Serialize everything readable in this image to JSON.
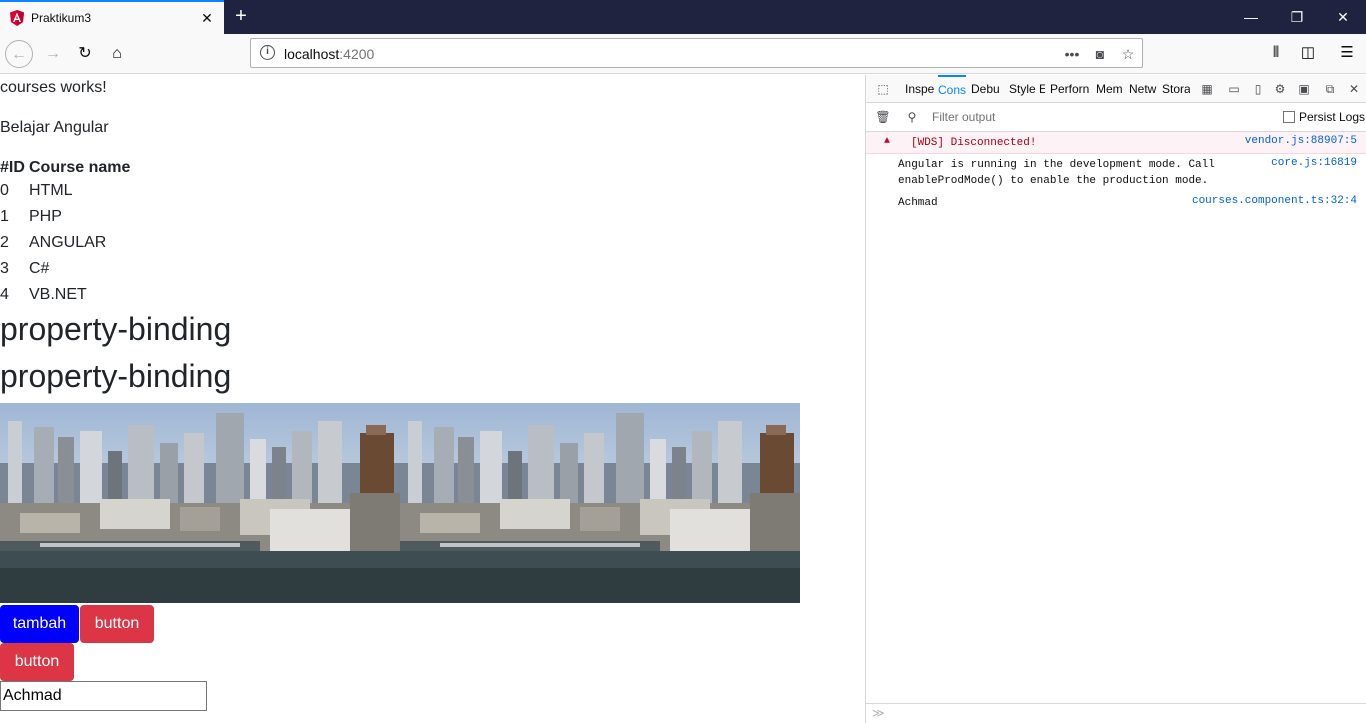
{
  "browser": {
    "tab_title": "Praktikum3",
    "url_host": "localhost",
    "url_port": ":4200"
  },
  "page": {
    "courses_works": "courses works!",
    "subtitle": "Belajar Angular",
    "table": {
      "headers": [
        "#ID",
        "Course name"
      ],
      "rows": [
        [
          "0",
          "HTML"
        ],
        [
          "1",
          "PHP"
        ],
        [
          "2",
          "ANGULAR"
        ],
        [
          "3",
          "C#"
        ],
        [
          "4",
          "VB.NET"
        ]
      ]
    },
    "heading_1": "property-binding",
    "heading_2": "property-binding",
    "buttons": {
      "tambah": "tambah",
      "button_1": "button",
      "button_2": "button"
    },
    "input_value": "Achmad"
  },
  "devtools": {
    "tabs": [
      "Inspe",
      "Cons",
      "Debu",
      "Style E",
      "Perforn",
      "Mem",
      "Netw",
      "Stora"
    ],
    "filter_placeholder": "Filter output",
    "persist_logs": "Persist Logs",
    "logs": [
      {
        "msg": "[WDS] Disconnected!",
        "src": "vendor.js:88907:5",
        "level": "error"
      },
      {
        "msg": "Angular is running in the development mode. Call\nenableProdMode() to enable the production mode.",
        "src": "core.js:16819",
        "level": "log"
      },
      {
        "msg": "Achmad",
        "src": "courses.component.ts:32:4",
        "level": "log"
      }
    ]
  },
  "colors": {
    "titlebar": "#202340",
    "primary_button": "#0000ff",
    "danger_button": "#dc3545",
    "devtools_active": "#0a84ff"
  }
}
